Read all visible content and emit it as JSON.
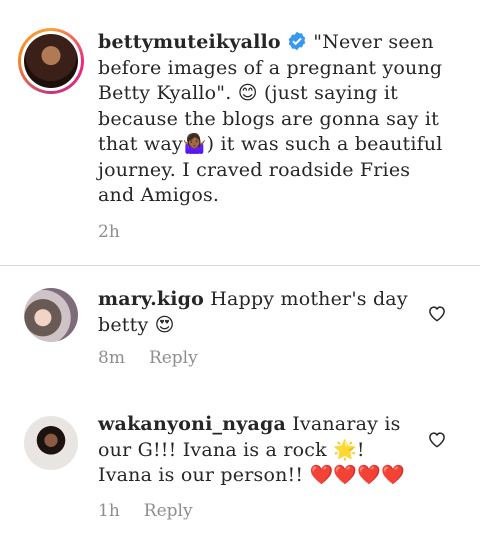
{
  "caption": {
    "username": "bettymuteikyallo",
    "body_1": " \"Never seen before images of a pregnant young Betty Kyallo\". ",
    "emoji_1": "😊",
    "body_2": " (just saying it because the blogs are gonna say it that way",
    "emoji_2": "🤷🏾‍♀️",
    "body_3": ") it was such a beautiful journey. I craved roadside Fries and Amigos.",
    "time": "2h"
  },
  "comments": [
    {
      "username": "mary.kigo",
      "text": " Happy mother's day betty ",
      "emoji": "😍",
      "time": "8m",
      "reply_label": "Reply"
    },
    {
      "username": "wakanyoni_nyaga",
      "text": " Ivanaray is our G!!! Ivana is a rock ",
      "emoji": "🌟",
      "text_2": "! Ivana is our person!! ",
      "hearts": "❤️❤️❤️❤️",
      "time": "1h",
      "reply_label": "Reply"
    }
  ],
  "colors": {
    "verified": "#3897f0",
    "meta": "#8e8e8e",
    "divider": "#dbdbdb"
  }
}
